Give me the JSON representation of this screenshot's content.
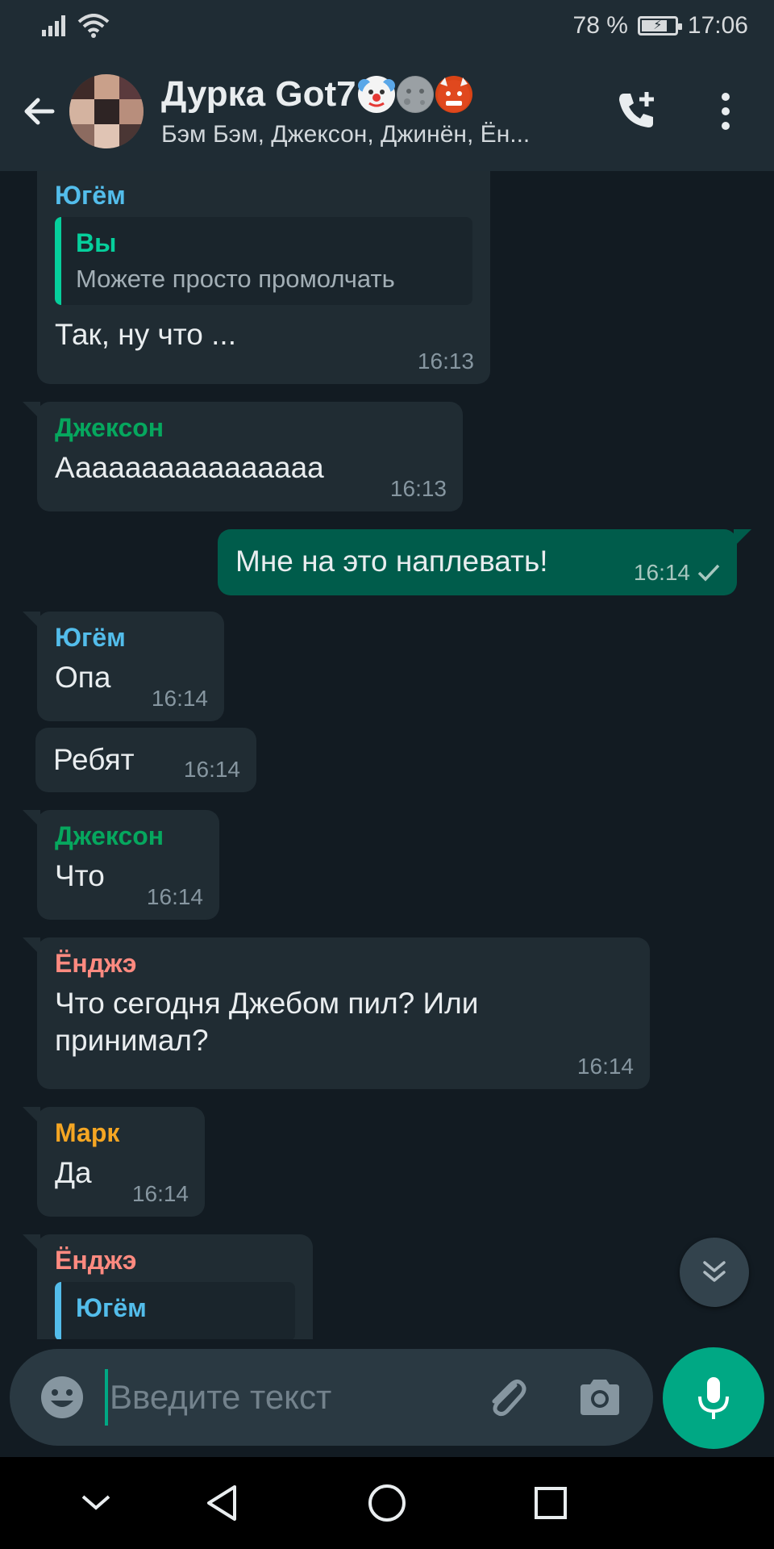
{
  "status_bar": {
    "battery": "78 %",
    "time": "17:06",
    "battery_level": 0.78
  },
  "header": {
    "title": "Дурка Got7",
    "title_emojis": [
      "clown-face",
      "new-moon-face",
      "ogre"
    ],
    "subtitle": "Бэм Бэм, Джексон, Джинён, Ён...",
    "icons": {
      "back": "arrow-left-icon",
      "call": "add-call-icon",
      "menu": "more-vert-icon"
    }
  },
  "colors": {
    "yugem": "#53bdeb",
    "jackson": "#06a75e",
    "youngjae": "#ff8a80",
    "mark": "#f5a623",
    "you_quote": "#06cf9c",
    "bubble_in": "#202c33",
    "bubble_out": "#005c4b",
    "accent": "#00a884"
  },
  "messages": [
    {
      "sender": "Югём",
      "quote_name": "Вы",
      "quote_text": "Можете просто промолчать",
      "text": "Так,  ну что ...",
      "time": "16:13"
    },
    {
      "sender": "Джексон",
      "text": "Аааааааааааааааа",
      "time": "16:13"
    },
    {
      "text": "Мне на это наплевать!",
      "time": "16:14",
      "outgoing": true
    },
    {
      "sender": "Югём",
      "text": "Опа",
      "time": "16:14"
    },
    {
      "text": "Ребят",
      "time": "16:14"
    },
    {
      "sender": "Джексон",
      "text": "Что",
      "time": "16:14"
    },
    {
      "sender": "Ёнджэ",
      "text": "Что сегодня Джебом пил? Или принимал?",
      "time": "16:14"
    },
    {
      "sender": "Марк",
      "text": "Да",
      "time": "16:14"
    },
    {
      "sender": "Ёнджэ",
      "quote_name": "Югём"
    }
  ],
  "input": {
    "placeholder": "Введите текст"
  },
  "nav": {
    "icons": [
      "chevron-down-icon",
      "back-triangle-icon",
      "home-circle-icon",
      "recents-square-icon"
    ]
  }
}
